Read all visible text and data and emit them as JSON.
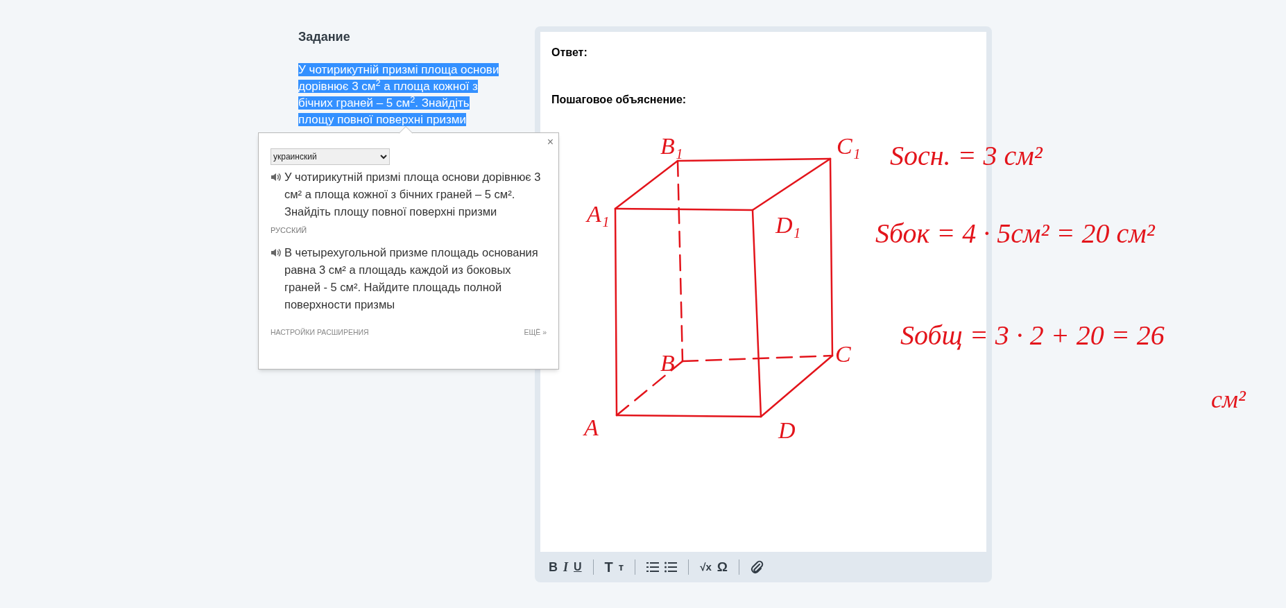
{
  "task": {
    "heading": "Задание",
    "text": "У чотирикутній призмі площа основи дорівнює 3 см$^{2}$ а площа кожної з бічних граней – 5 см$^{2}$. Знайдіть площу повної поверхні призми",
    "highlighted": true
  },
  "answer": {
    "answer_label": "Ответ:",
    "explanation_label": "Пошаговое объяснение:",
    "drawing": {
      "vertex_labels": [
        "B₁",
        "C₁",
        "A₁",
        "D₁",
        "B",
        "C",
        "A",
        "D"
      ],
      "formulas": [
        "Sосн. = 3 см²",
        "Sбок = 4 · 5см² = 20 см²",
        "Sобщ = 3 · 2 + 20 = 26",
        "см²"
      ]
    },
    "toolbar": [
      [
        {
          "kind": "bold",
          "label": "B"
        },
        {
          "kind": "italic",
          "label": "I"
        },
        {
          "kind": "underline",
          "label": "U"
        }
      ],
      [
        {
          "kind": "heading",
          "label": "T"
        },
        {
          "kind": "subheading",
          "label": "т"
        }
      ],
      [
        {
          "kind": "ordered-list"
        },
        {
          "kind": "bullet-list"
        }
      ],
      [
        {
          "kind": "formula",
          "label": "√x"
        },
        {
          "kind": "symbol",
          "label": "Ω"
        }
      ],
      [
        {
          "kind": "attachment"
        }
      ]
    ]
  },
  "translator_popup": {
    "close": "×",
    "source_language": "украинский",
    "source_text": "У чотирикутній призмі площа основи дорівнює 3 см² а площа кожної з бічних граней – 5 см². Знайдіть площу повної поверхні призми",
    "target_language": "РУССКИЙ",
    "target_text": "В четырехугольной призме площадь основания равна 3 см² а площадь каждой из боковых граней - 5 см². Найдите площадь полной поверхности призмы",
    "settings_link": "НАСТРОЙКИ РАСШИРЕНИЯ",
    "more_link": "ЕЩЁ »"
  }
}
